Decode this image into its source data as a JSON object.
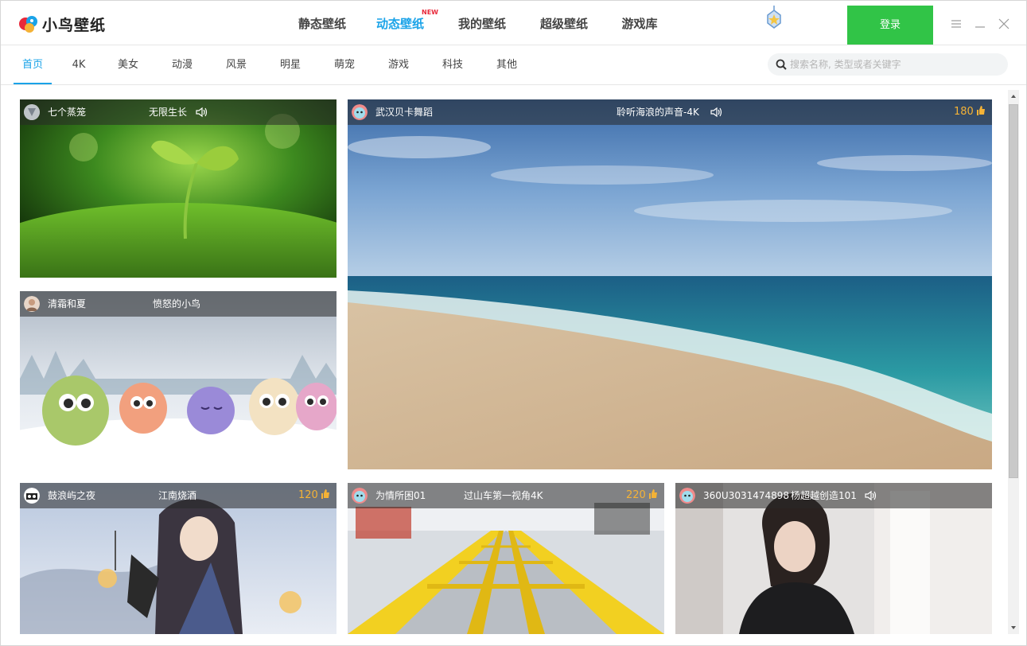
{
  "app": {
    "logo_text": "小鸟壁纸"
  },
  "nav": {
    "items": [
      {
        "label": "静态壁纸"
      },
      {
        "label": "动态壁纸",
        "badge": "NEW"
      },
      {
        "label": "我的壁纸"
      },
      {
        "label": "超级壁纸"
      },
      {
        "label": "游戏库"
      }
    ],
    "active_index": 1,
    "login_label": "登录"
  },
  "tabs": {
    "items": [
      {
        "label": "首页"
      },
      {
        "label": "4K"
      },
      {
        "label": "美女"
      },
      {
        "label": "动漫"
      },
      {
        "label": "风景"
      },
      {
        "label": "明星"
      },
      {
        "label": "萌宠"
      },
      {
        "label": "游戏"
      },
      {
        "label": "科技"
      },
      {
        "label": "其他"
      }
    ],
    "active_index": 0
  },
  "search": {
    "placeholder": "搜索名称, 类型或者关键字"
  },
  "cards": [
    {
      "author": "七个蒸笼",
      "title": "无限生长",
      "sound": true
    },
    {
      "author": "武汉贝卡舞蹈",
      "title": "聆听海浪的声音-4K",
      "sound": true,
      "likes": "180"
    },
    {
      "author": "清霜和夏",
      "title": "愤怒的小鸟",
      "sound": false
    },
    {
      "author": "鼓浪屿之夜",
      "title": "江南烧酒",
      "sound": false,
      "likes": "120"
    },
    {
      "author": "为情所困01",
      "title": "过山车第一视角4K",
      "sound": false,
      "likes": "220"
    },
    {
      "author": "360U3031474898",
      "title": "杨超越创造101",
      "sound": true
    }
  ],
  "colors": {
    "accent": "#1aa3e8",
    "login": "#31c447",
    "badge": "#e8283a",
    "likes": "#f4b236"
  }
}
